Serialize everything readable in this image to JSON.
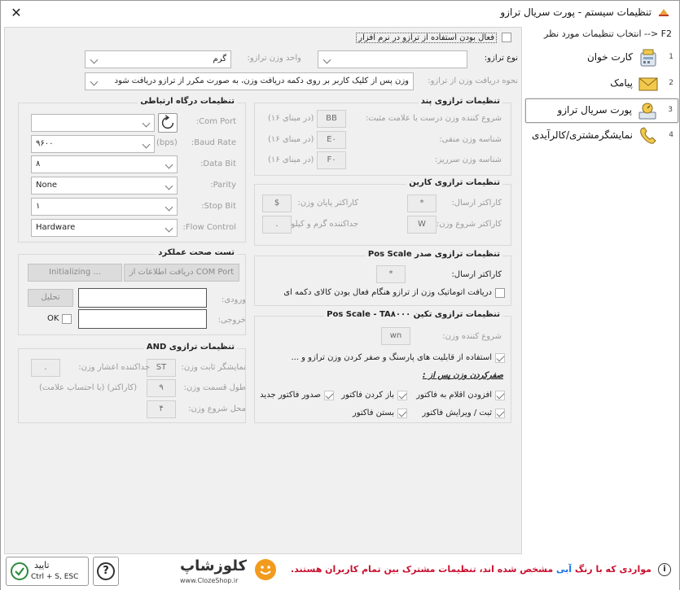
{
  "window": {
    "title": "تنظیمات سیستم - پورت سریال ترازو",
    "close_glyph": "✕"
  },
  "sidebar": {
    "header": "F2 <-- انتخاب تنظیمات مورد نظر",
    "items": [
      {
        "num": "1",
        "label": "کارت خوان",
        "icon": "card-reader-icon"
      },
      {
        "num": "2",
        "label": "پیامک",
        "icon": "envelope-icon"
      },
      {
        "num": "3",
        "label": "پورت سریال ترازو",
        "icon": "scale-icon"
      },
      {
        "num": "4",
        "label": "نمایشگرمشتری/کالرآیدی",
        "icon": "phone-icon"
      }
    ]
  },
  "top": {
    "enable_label": "فعال بودن استفاده از ترازو در نرم افزار",
    "scale_type_label": "نوع ترازو:",
    "scale_type_value": "",
    "weight_unit_label": "واحد وزن ترازو:",
    "weight_unit_value": "گرم",
    "receive_label": "نحوه دریافت وزن از ترازو:",
    "receive_value": "وزن پس از کلیک کاربر بر روی دکمه دریافت وزن، به صورت مکرر از ترازو دریافت شود"
  },
  "conn": {
    "title": "تنظیمات درگاه ارتباطی",
    "com_port_label": "Com Port:",
    "com_port_value": "",
    "baud_label": "Baud Rate:",
    "baud_value": "۹۶۰۰",
    "bps": "(bps)",
    "databit_label": "Data Bit:",
    "databit_value": "۸",
    "parity_label": "Parity:",
    "parity_value": "None",
    "stopbit_label": "Stop Bit:",
    "stopbit_value": "۱",
    "flow_label": "Flow Control:",
    "flow_value": "Hardware"
  },
  "pand": {
    "title": "تنظیمات ترازوی پند",
    "r1_label": "شروع کننده وزن درست با علامت مثبت:",
    "r1_value": "BB",
    "r1_unit": "(در مبنای ۱۶)",
    "r2_label": "شناسه وزن منفی:",
    "r2_value": "E۰",
    "r2_unit": "(در مبنای ۱۶)",
    "r3_label": "شناسه وزن سرریز:",
    "r3_value": "F۰",
    "r3_unit": "(در مبنای ۱۶)"
  },
  "karin": {
    "title": "تنظیمات ترازوی کارین",
    "send_label": "کاراکتر ارسال:",
    "send_value": "*",
    "end_label": "کاراکتر پایان وزن:",
    "end_value": "$",
    "start_label": "کاراکتر شروع وزن:",
    "start_value": "W",
    "sep_label": "جداکننده گرم و کیلوگرم:",
    "sep_value": "."
  },
  "test": {
    "title": "تست صحت عملکرد",
    "receive_btn": "دریافت اطلاعات از COM Port",
    "init_btn": "Initializing ...",
    "input_label": "ورودی:",
    "input_value": "",
    "analyze_btn": "تحلیل",
    "output_label": "خروجی:",
    "output_value": "",
    "ok_label": "OK"
  },
  "sadr": {
    "title": "تنظیمات ترازوی صدر Pos Scale",
    "send_label": "کاراکتر ارسال:",
    "send_value": "*",
    "auto_label": "دریافت اتوماتیک وزن از ترازو هنگام فعال بودن کالای دکمه ای"
  },
  "and": {
    "title": "تنظیمات ترازوی AND",
    "fixed_label": "نمایشگر ثابت وزن:",
    "fixed_value": "ST",
    "dec_label": "جداکننده اعشار وزن:",
    "dec_value": ".",
    "len_label": "طول قسمت وزن:",
    "len_value": "۹",
    "len_unit": "(کاراکتر)   (با احتساب علامت)",
    "pos_label": "محل شروع وزن:",
    "pos_value": "۴"
  },
  "takin": {
    "title": "تنظیمات ترازوی تکین Pos Scale - TA۸۰۰۰",
    "start_label": "شروع کننده وزن:",
    "start_value": "wn",
    "use_label": "استفاده از قابلیت های پارسنگ و صفر کردن وزن ترازو و ...",
    "zero_title": "صفرکردن وزن پس از :",
    "c1": "افزودن اقلام به فاکتور",
    "c2": "باز کردن فاکتور",
    "c3": "صدور فاکتور جدید",
    "c4": "ثبت / ویرایش فاکتور",
    "c5": "بستن فاکتور"
  },
  "footer": {
    "ok_label": "تایید",
    "ok_shortcut": "Ctrl + S, ESC",
    "help_glyph": "?",
    "logo_text": "کلوزشاپ",
    "logo_url": "www.ClozeShop.ir",
    "note_pre": "مواردی که با رنگ",
    "note_blue": "آبی",
    "note_post": "مشخص شده اند، تنظیمات مشترک بین تمام کاربران هستند.",
    "info_glyph": "i"
  },
  "colors": {
    "note_red": "#c8102e",
    "note_blue": "#1a73e8",
    "panel_bg": "#f0f0f0"
  }
}
